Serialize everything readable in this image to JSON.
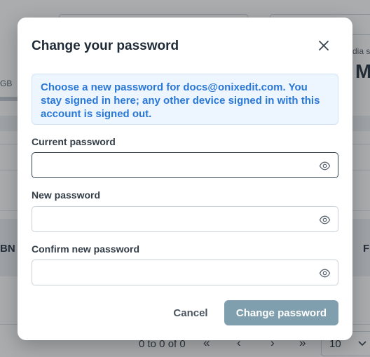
{
  "background": {
    "media_label": "dia s",
    "big_letter": "M",
    "storage_unit": "GB",
    "col_left": "BN",
    "col_right": "F",
    "pagination_text": "0 to 0 of 0",
    "first_page": "«",
    "prev_page": "‹",
    "next_page": "›",
    "last_page": "»",
    "page_size": "10"
  },
  "modal": {
    "title": "Change your password",
    "info": "Choose a new password for docs@onixedit.com. You stay signed in here; any other device signed in with this account is signed out.",
    "fields": [
      {
        "label": "Current password",
        "value": "",
        "placeholder": ""
      },
      {
        "label": "New password",
        "value": "",
        "placeholder": ""
      },
      {
        "label": "Confirm new password",
        "value": "",
        "placeholder": ""
      }
    ],
    "cancel_label": "Cancel",
    "submit_label": "Change password"
  },
  "colors": {
    "info_text": "#2a78d6",
    "info_bg": "#edf5ff",
    "primary_button": "#7f9fae",
    "title": "#1f2a37"
  },
  "icons": {
    "close": "close-icon",
    "reveal": "eye-icon"
  }
}
